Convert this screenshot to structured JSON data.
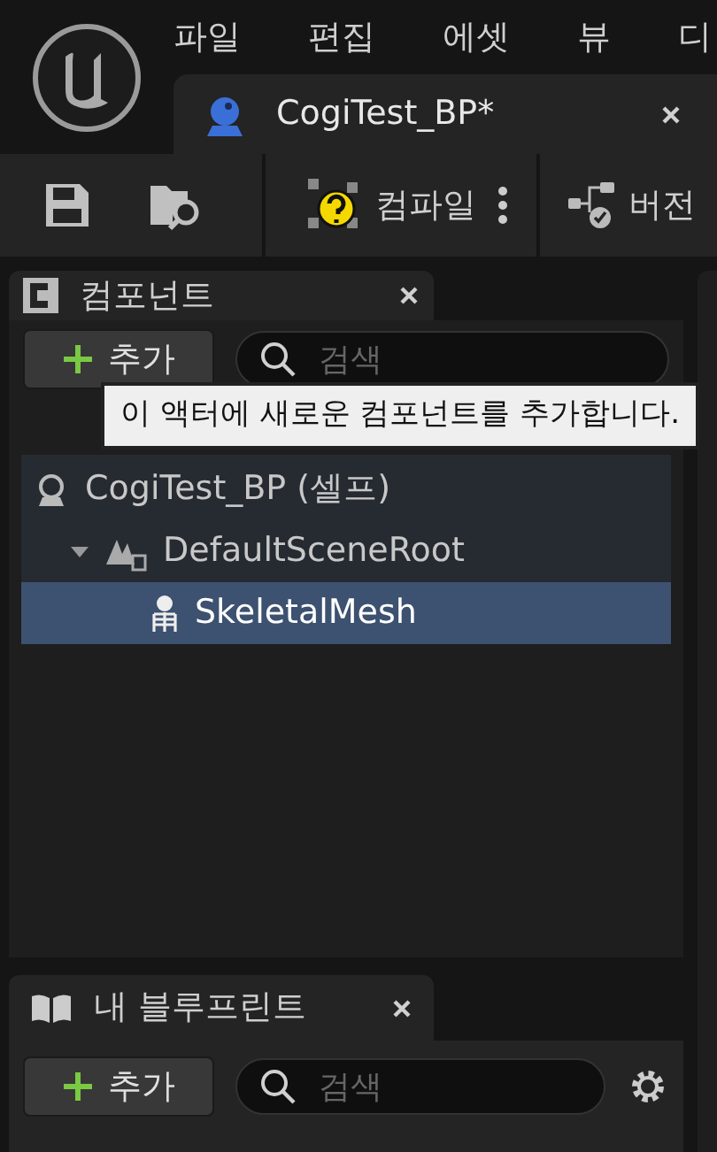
{
  "menu": [
    "파일",
    "편집",
    "에셋",
    "뷰",
    "디"
  ],
  "document_tab": {
    "title": "CogiTest_BP*"
  },
  "toolbar": {
    "compile": "컴파일",
    "version": "버전"
  },
  "components_panel": {
    "title": "컴포넌트",
    "add_button": "추가",
    "search": {
      "placeholder": "검색"
    },
    "tree": [
      {
        "label": "CogiTest_BP (셀프)",
        "kind": "actor",
        "selected": false,
        "children": [
          {
            "label": "DefaultSceneRoot",
            "kind": "scene",
            "selected": false,
            "expanded": true,
            "children": [
              {
                "label": "SkeletalMesh",
                "kind": "skeletal",
                "selected": true
              }
            ]
          }
        ]
      }
    ]
  },
  "tooltip": "이 액터에 새로운 컴포넌트를 추가합니다.",
  "blueprint_panel": {
    "title": "내 블루프린트",
    "add_button": "추가",
    "search": {
      "placeholder": "검색"
    }
  }
}
